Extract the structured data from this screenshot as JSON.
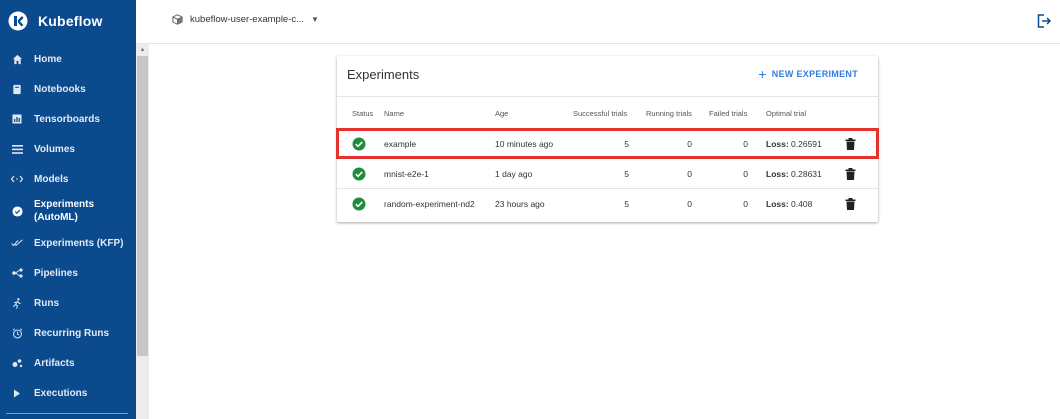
{
  "app": {
    "brand": "Kubeflow",
    "accent_color": "#0b4a8c",
    "link_color": "#2f7de1"
  },
  "sidebar": {
    "items": [
      {
        "label": "Home",
        "icon": "home-icon"
      },
      {
        "label": "Notebooks",
        "icon": "notebook-icon"
      },
      {
        "label": "Tensorboards",
        "icon": "chart-icon"
      },
      {
        "label": "Volumes",
        "icon": "list-icon"
      },
      {
        "label": "Models",
        "icon": "code-arrows-icon"
      },
      {
        "label": "Experiments\n(AutoML)",
        "icon": "experiment-icon",
        "active": true
      },
      {
        "label": "Experiments (KFP)",
        "icon": "check-double-icon"
      },
      {
        "label": "Pipelines",
        "icon": "pipeline-icon"
      },
      {
        "label": "Runs",
        "icon": "runner-icon"
      },
      {
        "label": "Recurring Runs",
        "icon": "alarm-icon"
      },
      {
        "label": "Artifacts",
        "icon": "artifacts-icon"
      },
      {
        "label": "Executions",
        "icon": "play-icon"
      }
    ]
  },
  "topbar": {
    "namespace": "kubeflow-user-example-c...",
    "logout_icon": "logout-icon"
  },
  "experiments": {
    "title": "Experiments",
    "new_button": "NEW EXPERIMENT",
    "columns": [
      "Status",
      "Name",
      "Age",
      "Successful trials",
      "Running trials",
      "Failed trials",
      "Optimal trial"
    ],
    "rows": [
      {
        "status": "succeeded",
        "name": "example",
        "age": "10 minutes ago",
        "successful": "5",
        "running": "0",
        "failed": "0",
        "loss_label": "Loss:",
        "loss_value": " 0.26591"
      },
      {
        "status": "succeeded",
        "name": "mnist-e2e-1",
        "age": "1 day ago",
        "successful": "5",
        "running": "0",
        "failed": "0",
        "loss_label": "Loss:",
        "loss_value": " 0.28631"
      },
      {
        "status": "succeeded",
        "name": "random-experiment-nd2",
        "age": "23 hours ago",
        "successful": "5",
        "running": "0",
        "failed": "0",
        "loss_label": "Loss:",
        "loss_value": " 0.408"
      }
    ],
    "highlight_color": "#e5322f"
  }
}
